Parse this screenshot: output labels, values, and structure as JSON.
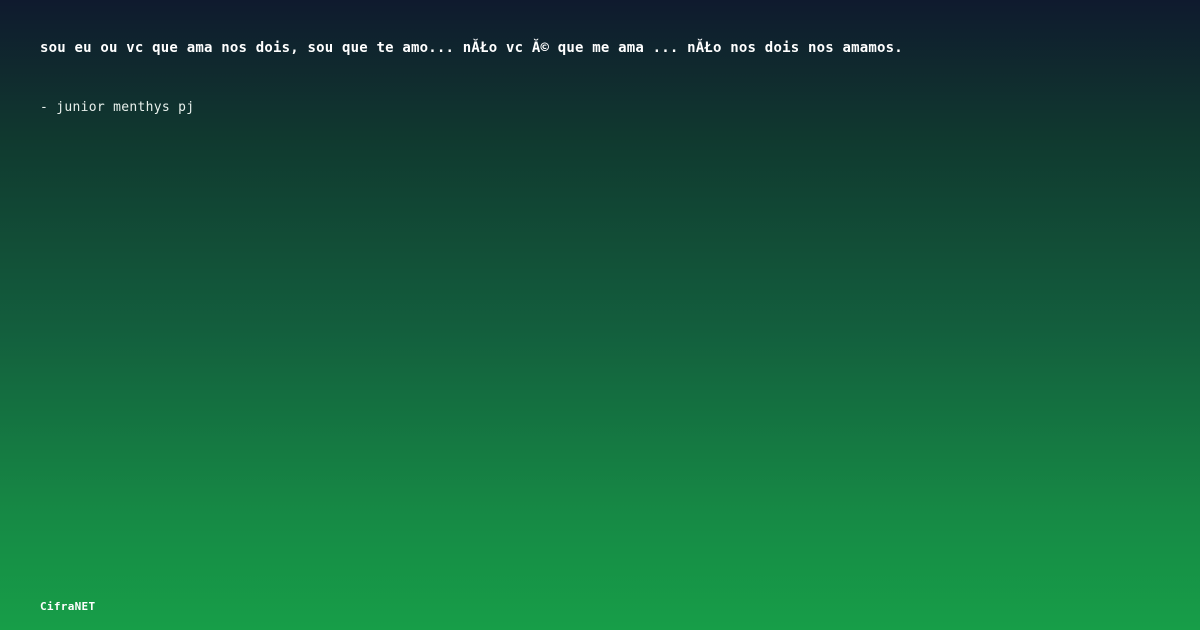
{
  "quote": {
    "text": "sou eu ou vc que ama nos dois, sou que te amo... nĂŁo vc Ă© que me ama ... nĂŁo nos dois nos amamos.",
    "author": "- junior menthys pj"
  },
  "brand": {
    "name": "CifraNET"
  },
  "colors": {
    "background_top": "#0f1a2e",
    "background_bottom": "#179e48",
    "text": "#ffffff"
  }
}
